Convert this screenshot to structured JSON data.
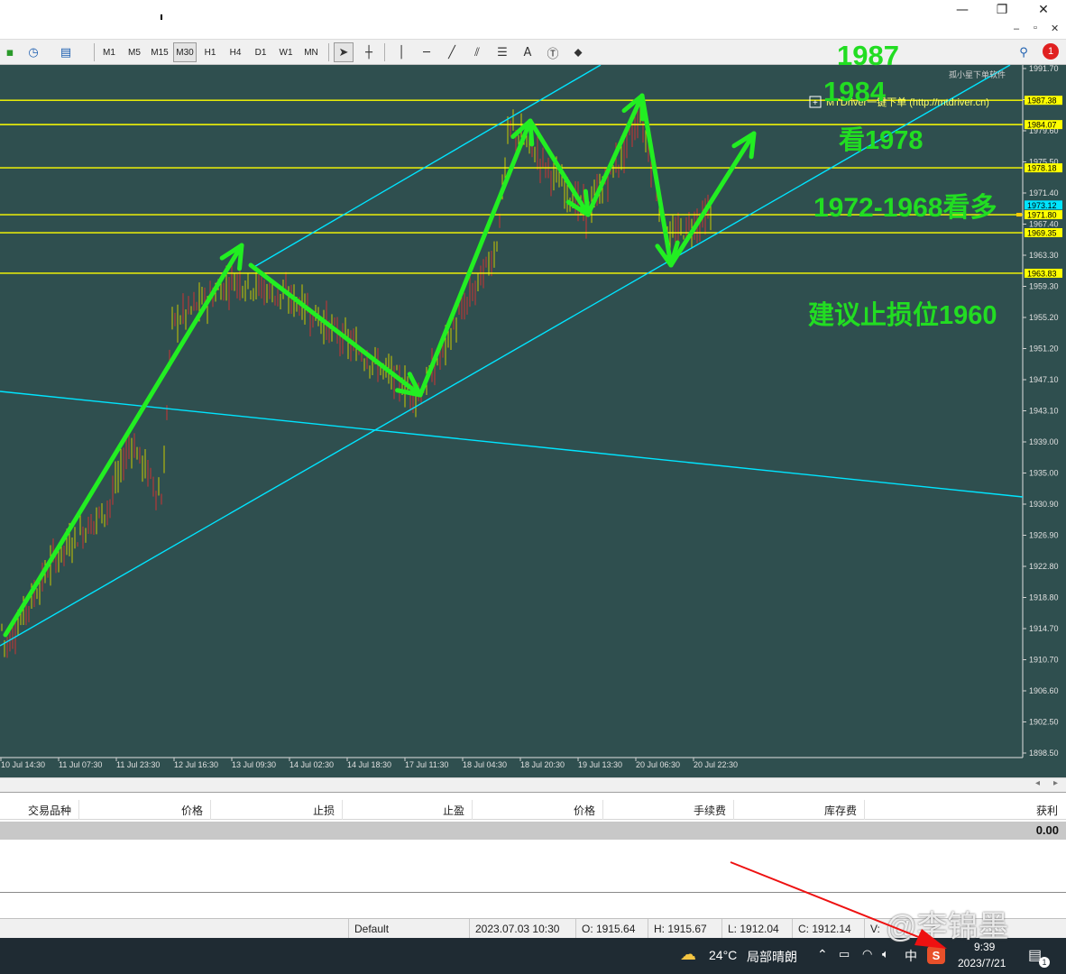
{
  "window": {
    "controls": [
      "—",
      "❐",
      "✕"
    ],
    "inner_controls": [
      "–",
      "▫",
      "✕"
    ]
  },
  "toolbar": {
    "timeframes": [
      "M1",
      "M5",
      "M15",
      "M30",
      "H1",
      "H4",
      "D1",
      "W1",
      "MN"
    ],
    "active_timeframe": "M30",
    "notification_count": "1"
  },
  "chart": {
    "price_ticks": [
      "1991.70",
      "1983.45",
      "1979.60",
      "1975.50",
      "1971.40",
      "1967.40",
      "1963.30",
      "1959.30",
      "1955.20",
      "1951.20",
      "1947.10",
      "1943.10",
      "1939.00",
      "1935.00",
      "1930.90",
      "1926.90",
      "1922.80",
      "1918.80",
      "1914.70",
      "1910.70",
      "1906.60",
      "1902.50",
      "1898.50"
    ],
    "time_ticks": [
      "10 Jul 14:30",
      "11 Jul 07:30",
      "11 Jul 23:30",
      "12 Jul 16:30",
      "13 Jul 09:30",
      "14 Jul 02:30",
      "14 Jul 18:30",
      "17 Jul 11:30",
      "18 Jul 04:30",
      "18 Jul 20:30",
      "19 Jul 13:30",
      "20 Jul 06:30",
      "20 Jul 22:30"
    ],
    "horizontal_levels": [
      {
        "price": 1987.38,
        "label": "1987.38"
      },
      {
        "price": 1984.07,
        "label": "1984.07"
      },
      {
        "price": 1978.18,
        "label": "1978.18"
      },
      {
        "price": 1971.8,
        "label": "1971.80"
      },
      {
        "price": 1969.35,
        "label": "1969.35"
      },
      {
        "price": 1963.83,
        "label": "1963.83"
      }
    ],
    "current_price_label": "1973.12",
    "ea_label": "孤小星下单软件",
    "plugin_label": "MTDriver一键下单 (http://mtdriver.cn)",
    "colors": {
      "background": "#2f4f4f",
      "levels": "#ffff00",
      "channel": "#00ffff",
      "arrows": "#22ee22",
      "candles_up": "#c8c800",
      "candles_down": "#cc3333"
    }
  },
  "annotations": [
    {
      "text": "1987"
    },
    {
      "text": "1984"
    },
    {
      "text": "看1978"
    },
    {
      "text": "1972-1968看多"
    },
    {
      "text": "建议止损位1960"
    }
  ],
  "terminal": {
    "columns": [
      "交易品种",
      "价格",
      "止损",
      "止盈",
      "价格",
      "手续费",
      "库存费",
      "获利"
    ],
    "balance_profit": "0.00"
  },
  "status_bar": {
    "profile": "Default",
    "datetime": "2023.07.03 10:30",
    "open": "O: 1915.64",
    "high": "H: 1915.67",
    "low": "L: 1912.04",
    "close": "C: 1912.14",
    "volume": "V:"
  },
  "taskbar": {
    "weather_temp": "24°C",
    "weather_desc": "局部晴朗",
    "ime": "中",
    "time": "9:39",
    "date": "2023/7/21",
    "notifications": "1"
  },
  "watermark": "@李锦墨"
}
